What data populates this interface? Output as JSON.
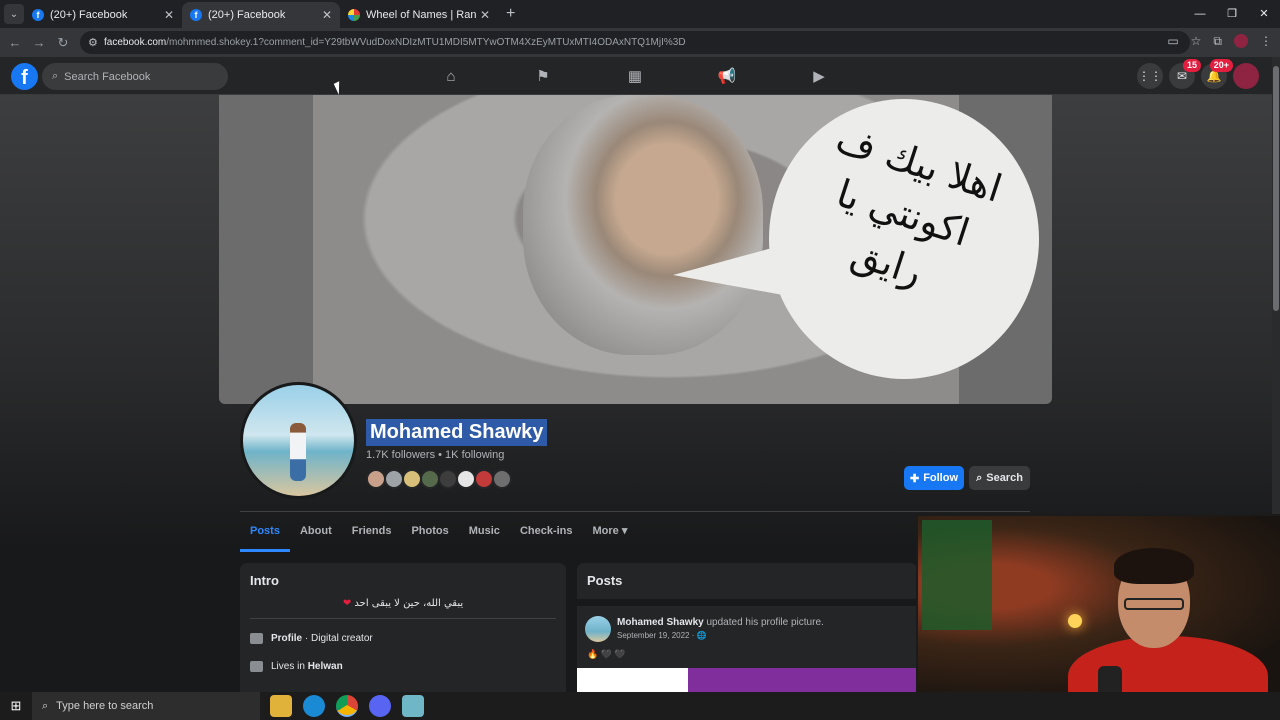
{
  "browser": {
    "tabs": [
      {
        "title": "(20+) Facebook",
        "active": false
      },
      {
        "title": "(20+) Facebook",
        "active": true
      },
      {
        "title": "Wheel of Names | Random nan",
        "active": false
      }
    ],
    "url_host": "facebook.com",
    "url_path": "/mohmmed.shokey.1?comment_id=Y29tbWVudDoxNDIzMTU1MDI5MTYwOTM4XzEyMTUxMTI4ODAxNTQ1MjI%3D"
  },
  "fb_header": {
    "search_placeholder": "Search Facebook",
    "messenger_badge": "15",
    "notifications_badge": "20+"
  },
  "cover": {
    "bubble_text": "اهلا بيك ف اكونتي يا رايق"
  },
  "profile": {
    "name": "Mohamed Shawky",
    "followers": "1.7K followers • 1K following",
    "follow_label": "Follow",
    "search_label": "Search"
  },
  "profile_tabs": [
    "Posts",
    "About",
    "Friends",
    "Photos",
    "Music",
    "Check-ins",
    "More"
  ],
  "intro": {
    "title": "Intro",
    "bio": "يبقي الله، حين لا يبقى احد",
    "profile_label": "Profile",
    "profile_value": "· Digital creator",
    "lives_label": "Lives in",
    "lives_value": "Helwan"
  },
  "posts": {
    "title": "Posts",
    "author": "Mohamed Shawky",
    "action": "updated his profile picture.",
    "date": "September 19, 2022 ·"
  },
  "taskbar": {
    "search_placeholder": "Type here to search"
  },
  "colors": {
    "fb_blue": "#1877f2",
    "name_highlight": "#2f5aa8",
    "badge_red": "#e41e3f"
  }
}
